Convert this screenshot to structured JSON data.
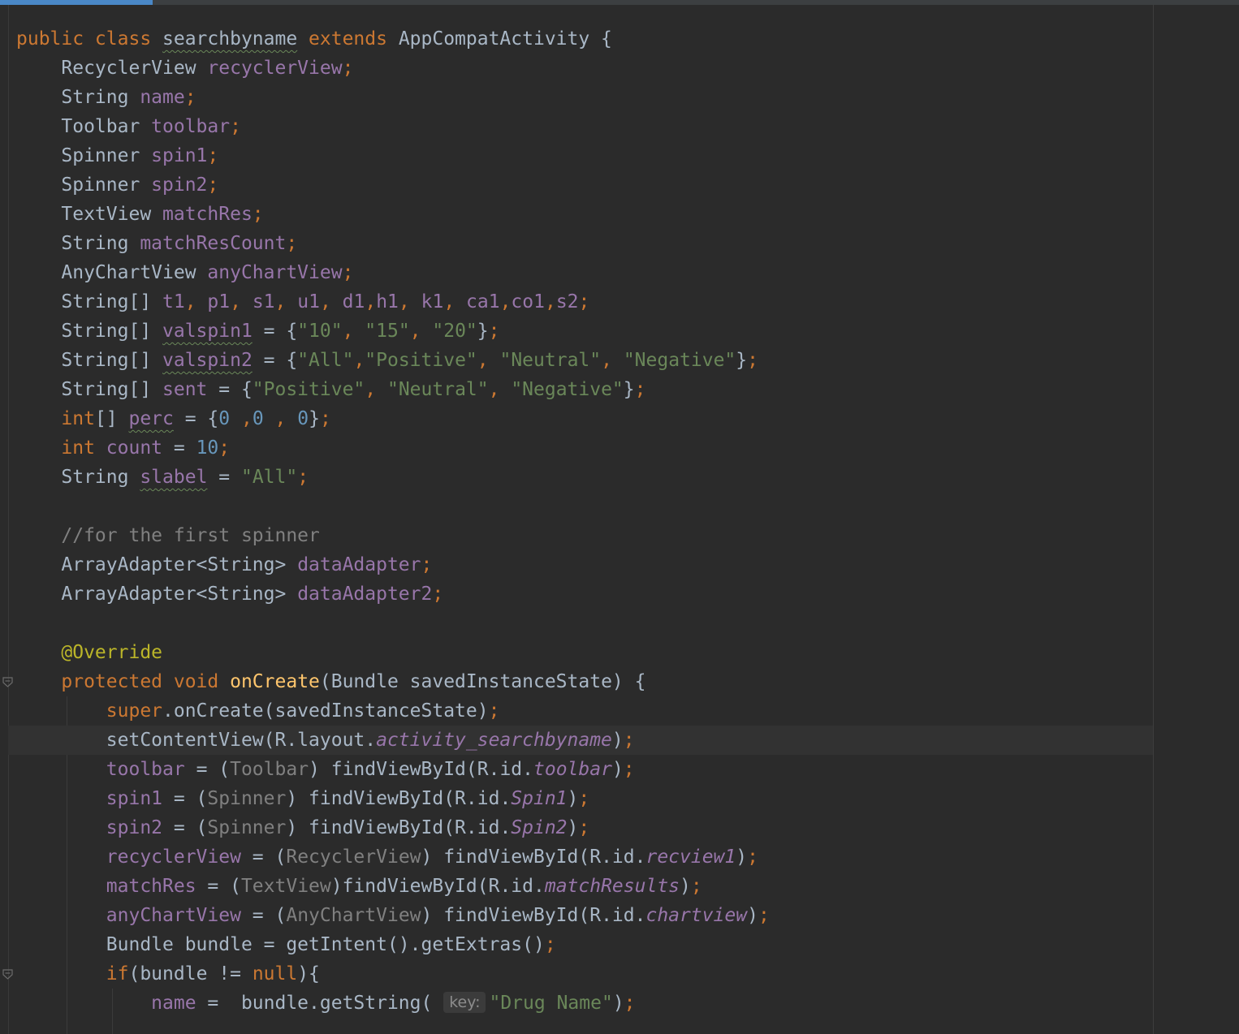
{
  "editor": {
    "active_line": 24,
    "lines": [
      [
        [
          "kw",
          "public class "
        ],
        [
          "plain squig",
          "searchbyname"
        ],
        [
          "kw",
          " extends "
        ],
        [
          "plain",
          "AppCompatActivity {"
        ]
      ],
      [
        [
          "plain",
          "    RecyclerView "
        ],
        [
          "fld",
          "recyclerView"
        ],
        [
          "kw",
          ";"
        ]
      ],
      [
        [
          "plain",
          "    String "
        ],
        [
          "fld",
          "name"
        ],
        [
          "kw",
          ";"
        ]
      ],
      [
        [
          "plain",
          "    Toolbar "
        ],
        [
          "fld",
          "toolbar"
        ],
        [
          "kw",
          ";"
        ]
      ],
      [
        [
          "plain",
          "    Spinner "
        ],
        [
          "fld",
          "spin1"
        ],
        [
          "kw",
          ";"
        ]
      ],
      [
        [
          "plain",
          "    Spinner "
        ],
        [
          "fld",
          "spin2"
        ],
        [
          "kw",
          ";"
        ]
      ],
      [
        [
          "plain",
          "    TextView "
        ],
        [
          "fld",
          "matchRes"
        ],
        [
          "kw",
          ";"
        ]
      ],
      [
        [
          "plain",
          "    String "
        ],
        [
          "fld",
          "matchResCount"
        ],
        [
          "kw",
          ";"
        ]
      ],
      [
        [
          "plain",
          "    AnyChartView "
        ],
        [
          "fld",
          "anyChartView"
        ],
        [
          "kw",
          ";"
        ]
      ],
      [
        [
          "plain",
          "    String[] "
        ],
        [
          "fld",
          "t1"
        ],
        [
          "kw",
          ", "
        ],
        [
          "fld",
          "p1"
        ],
        [
          "kw",
          ", "
        ],
        [
          "fld",
          "s1"
        ],
        [
          "kw",
          ", "
        ],
        [
          "fld",
          "u1"
        ],
        [
          "kw",
          ", "
        ],
        [
          "fld",
          "d1"
        ],
        [
          "kw",
          ","
        ],
        [
          "fld",
          "h1"
        ],
        [
          "kw",
          ", "
        ],
        [
          "fld",
          "k1"
        ],
        [
          "kw",
          ", "
        ],
        [
          "fld",
          "ca1"
        ],
        [
          "kw",
          ","
        ],
        [
          "fld",
          "co1"
        ],
        [
          "kw",
          ","
        ],
        [
          "fld",
          "s2"
        ],
        [
          "kw",
          ";"
        ]
      ],
      [
        [
          "plain",
          "    String[] "
        ],
        [
          "fld squig",
          "valspin1"
        ],
        [
          "plain",
          " = {"
        ],
        [
          "str",
          "\"10\""
        ],
        [
          "kw",
          ", "
        ],
        [
          "str",
          "\"15\""
        ],
        [
          "kw",
          ", "
        ],
        [
          "str",
          "\"20\""
        ],
        [
          "plain",
          "}"
        ],
        [
          "kw",
          ";"
        ]
      ],
      [
        [
          "plain",
          "    String[] "
        ],
        [
          "fld squig",
          "valspin2"
        ],
        [
          "plain",
          " = {"
        ],
        [
          "str",
          "\"All\""
        ],
        [
          "kw",
          ","
        ],
        [
          "str",
          "\"Positive\""
        ],
        [
          "kw",
          ", "
        ],
        [
          "str",
          "\"Neutral\""
        ],
        [
          "kw",
          ", "
        ],
        [
          "str",
          "\"Negative\""
        ],
        [
          "plain",
          "}"
        ],
        [
          "kw",
          ";"
        ]
      ],
      [
        [
          "plain",
          "    String[] "
        ],
        [
          "fld",
          "sent"
        ],
        [
          "plain",
          " = {"
        ],
        [
          "str",
          "\"Positive\""
        ],
        [
          "kw",
          ", "
        ],
        [
          "str",
          "\"Neutral\""
        ],
        [
          "kw",
          ", "
        ],
        [
          "str",
          "\"Negative\""
        ],
        [
          "plain",
          "}"
        ],
        [
          "kw",
          ";"
        ]
      ],
      [
        [
          "plain",
          "    "
        ],
        [
          "kw",
          "int"
        ],
        [
          "plain",
          "[] "
        ],
        [
          "fld squig",
          "perc"
        ],
        [
          "plain",
          " = {"
        ],
        [
          "num",
          "0"
        ],
        [
          "kw",
          " ,"
        ],
        [
          "num",
          "0"
        ],
        [
          "kw",
          " , "
        ],
        [
          "num",
          "0"
        ],
        [
          "plain",
          "}"
        ],
        [
          "kw",
          ";"
        ]
      ],
      [
        [
          "plain",
          "    "
        ],
        [
          "kw",
          "int "
        ],
        [
          "fld",
          "count"
        ],
        [
          "plain",
          " = "
        ],
        [
          "num",
          "10"
        ],
        [
          "kw",
          ";"
        ]
      ],
      [
        [
          "plain",
          "    String "
        ],
        [
          "fld squig",
          "slabel"
        ],
        [
          "plain",
          " = "
        ],
        [
          "str",
          "\"All\""
        ],
        [
          "kw",
          ";"
        ]
      ],
      [
        [
          "plain",
          ""
        ]
      ],
      [
        [
          "cmt",
          "    //for the first spinner"
        ]
      ],
      [
        [
          "plain",
          "    ArrayAdapter<String> "
        ],
        [
          "fld",
          "dataAdapter"
        ],
        [
          "kw",
          ";"
        ]
      ],
      [
        [
          "plain",
          "    ArrayAdapter<String> "
        ],
        [
          "fld",
          "dataAdapter2"
        ],
        [
          "kw",
          ";"
        ]
      ],
      [
        [
          "plain",
          ""
        ]
      ],
      [
        [
          "ann",
          "    @Override"
        ]
      ],
      [
        [
          "kw",
          "    protected void "
        ],
        [
          "mth",
          "onCreate"
        ],
        [
          "plain",
          "(Bundle savedInstanceState) {"
        ]
      ],
      [
        [
          "kw",
          "        super"
        ],
        [
          "plain",
          ".onCreate(savedInstanceState)"
        ],
        [
          "kw",
          ";"
        ]
      ],
      [
        [
          "plain",
          "        setContentView(R.layout."
        ],
        [
          "fld it",
          "activity_searchbyname"
        ],
        [
          "plain",
          ")"
        ],
        [
          "kw",
          ";"
        ]
      ],
      [
        [
          "fld",
          "        toolbar"
        ],
        [
          "plain",
          " = ("
        ],
        [
          "cast",
          "Toolbar"
        ],
        [
          "plain",
          ") findViewById(R.id."
        ],
        [
          "fld it",
          "toolbar"
        ],
        [
          "plain",
          ")"
        ],
        [
          "kw",
          ";"
        ]
      ],
      [
        [
          "fld",
          "        spin1"
        ],
        [
          "plain",
          " = ("
        ],
        [
          "cast",
          "Spinner"
        ],
        [
          "plain",
          ") findViewById(R.id."
        ],
        [
          "fld it",
          "Spin1"
        ],
        [
          "plain",
          ")"
        ],
        [
          "kw",
          ";"
        ]
      ],
      [
        [
          "fld",
          "        spin2"
        ],
        [
          "plain",
          " = ("
        ],
        [
          "cast",
          "Spinner"
        ],
        [
          "plain",
          ") findViewById(R.id."
        ],
        [
          "fld it",
          "Spin2"
        ],
        [
          "plain",
          ")"
        ],
        [
          "kw",
          ";"
        ]
      ],
      [
        [
          "fld",
          "        recyclerView"
        ],
        [
          "plain",
          " = ("
        ],
        [
          "cast",
          "RecyclerView"
        ],
        [
          "plain",
          ") findViewById(R.id."
        ],
        [
          "fld it",
          "recview1"
        ],
        [
          "plain",
          ")"
        ],
        [
          "kw",
          ";"
        ]
      ],
      [
        [
          "fld",
          "        matchRes"
        ],
        [
          "plain",
          " = ("
        ],
        [
          "cast",
          "TextView"
        ],
        [
          "plain",
          ")findViewById(R.id."
        ],
        [
          "fld it",
          "matchResults"
        ],
        [
          "plain",
          ")"
        ],
        [
          "kw",
          ";"
        ]
      ],
      [
        [
          "fld",
          "        anyChartView"
        ],
        [
          "plain",
          " = ("
        ],
        [
          "cast",
          "AnyChartView"
        ],
        [
          "plain",
          ") findViewById(R.id."
        ],
        [
          "fld it",
          "chartview"
        ],
        [
          "plain",
          ")"
        ],
        [
          "kw",
          ";"
        ]
      ],
      [
        [
          "plain",
          "        Bundle bundle = getIntent().getExtras()"
        ],
        [
          "kw",
          ";"
        ]
      ],
      [
        [
          "kw",
          "        if"
        ],
        [
          "plain",
          "(bundle != "
        ],
        [
          "kw",
          "null"
        ],
        [
          "plain",
          "){"
        ]
      ],
      [
        [
          "fld",
          "            name"
        ],
        [
          "plain",
          " =  bundle.getString( "
        ],
        [
          "hint",
          "key:"
        ],
        [
          "str",
          "\"Drug Name\""
        ],
        [
          "plain",
          ")"
        ],
        [
          "kw",
          ";"
        ]
      ]
    ]
  }
}
